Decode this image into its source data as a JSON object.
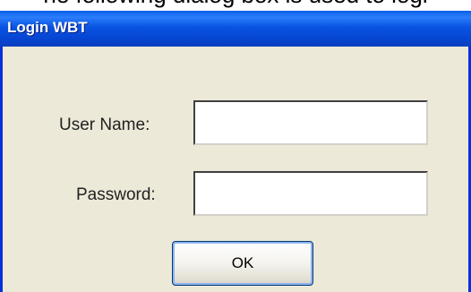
{
  "caption": "he following dialog box is used to logi",
  "window": {
    "title": "Login WBT"
  },
  "form": {
    "username_label": "User Name:",
    "username_value": "",
    "password_label": "Password:",
    "password_value": "",
    "ok_label": "OK"
  },
  "colors": {
    "titlebar": "#0a54e3",
    "dialog_background": "#ece9d8",
    "button_border": "#003c74"
  }
}
